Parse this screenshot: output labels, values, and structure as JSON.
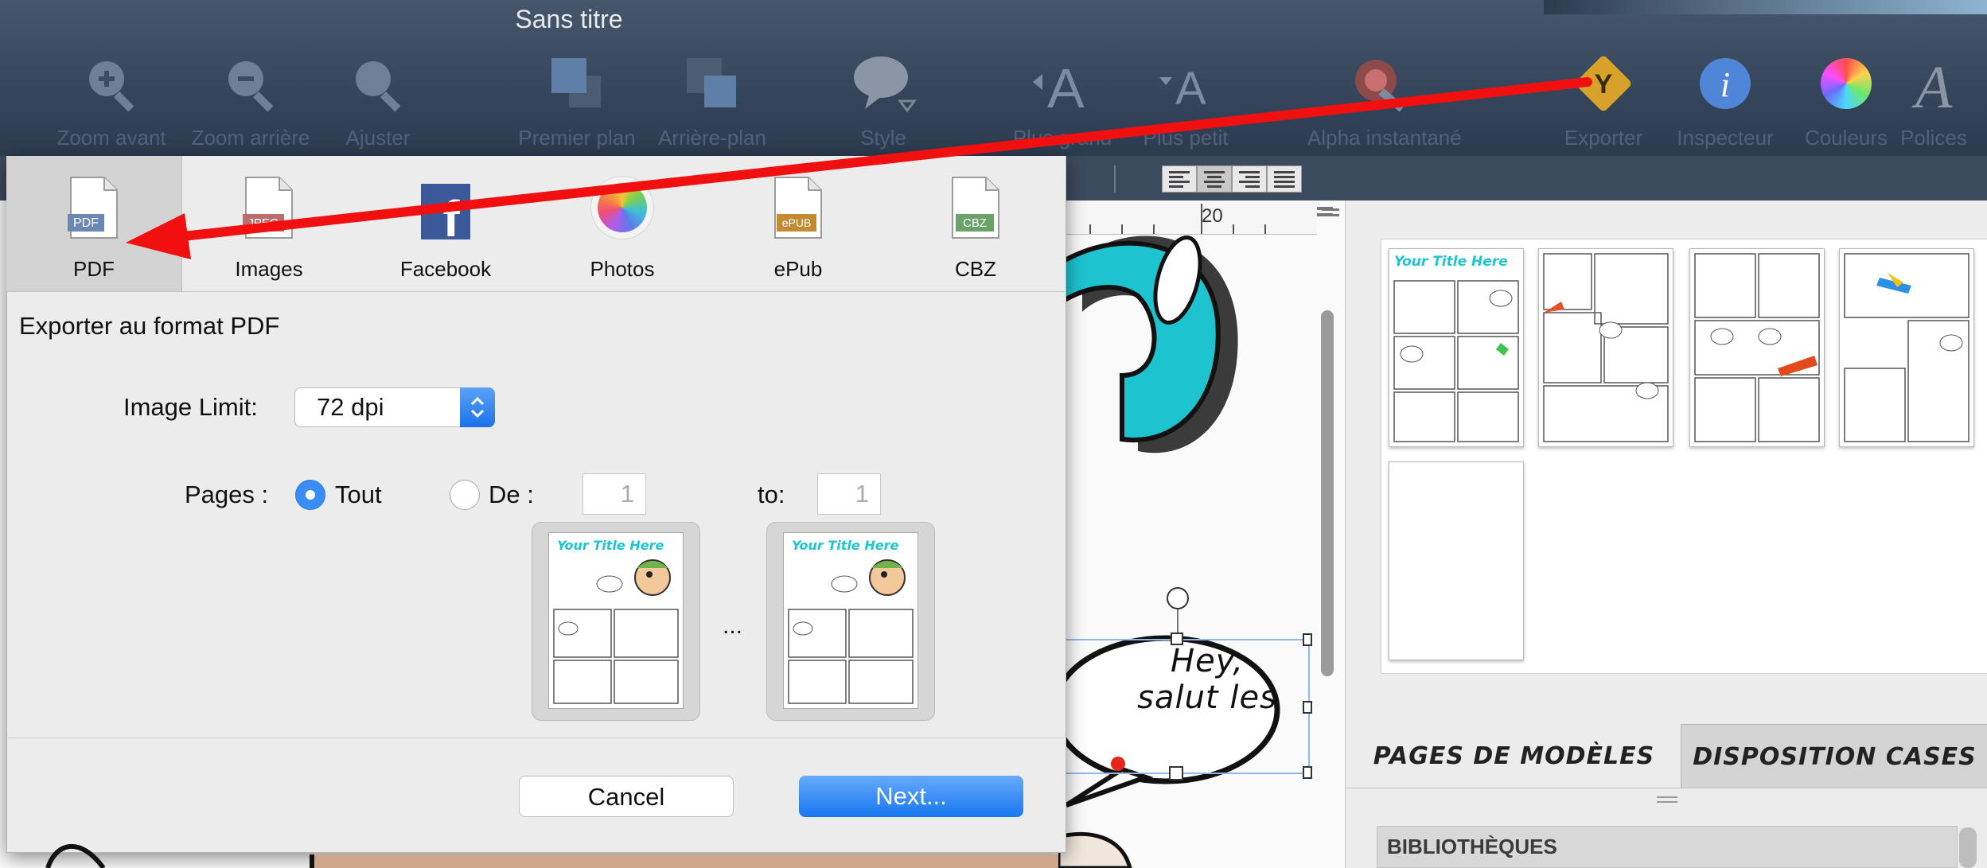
{
  "window": {
    "title": "Sans titre"
  },
  "toolbar": {
    "items": [
      {
        "label": "Zoom avant",
        "icon": "zoom-in-icon"
      },
      {
        "label": "Zoom arrière",
        "icon": "zoom-out-icon"
      },
      {
        "label": "Ajuster",
        "icon": "zoom-fit-icon"
      },
      {
        "label": "Premier plan",
        "icon": "bring-to-front-icon"
      },
      {
        "label": "Arrière-plan",
        "icon": "send-to-back-icon"
      },
      {
        "label": "Style",
        "icon": "speech-bubble-icon"
      },
      {
        "label": "Plus grand",
        "icon": "font-bigger-icon"
      },
      {
        "label": "Plus petit",
        "icon": "font-smaller-icon"
      },
      {
        "label": "Alpha instantané",
        "icon": "instant-alpha-icon"
      },
      {
        "label": "Exporter",
        "icon": "export-icon"
      },
      {
        "label": "Inspecteur",
        "icon": "inspector-icon"
      },
      {
        "label": "Couleurs",
        "icon": "color-wheel-icon"
      },
      {
        "label": "Polices",
        "icon": "fonts-icon"
      }
    ]
  },
  "ruler": {
    "mark": "20"
  },
  "export_sheet": {
    "formats": [
      {
        "label": "PDF",
        "icon": "pdf-file-icon",
        "badge": "PDF",
        "selected": true
      },
      {
        "label": "Images",
        "icon": "jpeg-file-icon",
        "badge": "JPEG"
      },
      {
        "label": "Facebook",
        "icon": "facebook-icon",
        "badge": "f"
      },
      {
        "label": "Photos",
        "icon": "photos-icon"
      },
      {
        "label": "ePub",
        "icon": "epub-file-icon",
        "badge": "ePUB"
      },
      {
        "label": "CBZ",
        "icon": "cbz-file-icon",
        "badge": "CBZ"
      }
    ],
    "heading": "Exporter au format PDF",
    "image_limit_label": "Image Limit:",
    "image_limit_value": "72 dpi",
    "pages_label": "Pages :",
    "all_label": "Tout",
    "from_label": "De :",
    "from_value": "1",
    "to_label": "to:",
    "to_value": "1",
    "preview_title": "Your Title Here",
    "ellipsis": "...",
    "cancel_label": "Cancel",
    "next_label": "Next..."
  },
  "canvas": {
    "speech_bubble_line1": "Hey,",
    "speech_bubble_line2": "salut les"
  },
  "right_panel": {
    "first_page_title": "Your Title Here",
    "tabs": [
      {
        "label": "PAGES DE MODÈLES",
        "selected": false
      },
      {
        "label": "DISPOSITION CASES",
        "selected": true
      }
    ],
    "library_header": "BIBLIOTHÈQUES"
  },
  "colors": {
    "toolbar_bg": "#3c4b60",
    "accent_blue": "#1c72ea",
    "annotation_red": "#f01010",
    "cyan_title": "#1cc6cf"
  }
}
